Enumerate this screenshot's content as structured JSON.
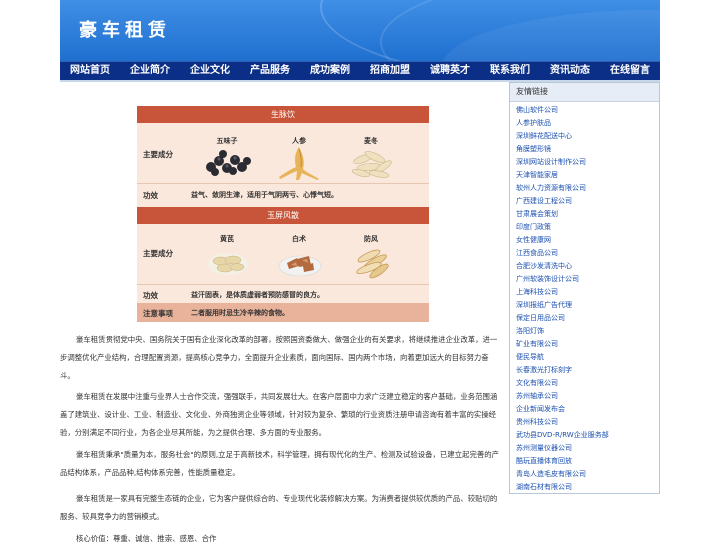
{
  "header": {
    "title": "豪车租赁"
  },
  "nav": {
    "items": [
      "网站首页",
      "企业简介",
      "企业文化",
      "产品服务",
      "成功案例",
      "招商加盟",
      "诚聘英才",
      "联系我们",
      "资讯动态",
      "在线留言"
    ]
  },
  "image": {
    "panel1": {
      "title": "生脉饮",
      "ingredients_label": "主要成分",
      "herbs": [
        "五味子",
        "人参",
        "麦冬"
      ],
      "effect_label": "功效",
      "effect_text": "益气、敛阴生津，适用于气阴两亏、心悸气短。"
    },
    "panel2": {
      "title": "玉屏风散",
      "ingredients_label": "主要成分",
      "herbs": [
        "黄芪",
        "白术",
        "防风"
      ],
      "effect_label": "功效",
      "effect_text": "益汗固表，是体质虚弱者预防感冒的良方。",
      "notes_label": "注意事项",
      "notes_text": "二者服用时忌生冷辛辣的食物。"
    }
  },
  "article": {
    "p1": "豪车租赁贯彻党中央、国务院关于国有企业深化改革的部署，按照国资委做大、做强企业的有关要求，将继续推进企业改革，进一步调整优化产业结构，合理配置资源，提高核心竞争力，全面提升企业素质，面向国际、国内两个市场，向着更加远大的目标努力奋斗。",
    "p2": "豪车租赁在发展中注重与业界人士合作交流，强强联手，共同发展壮大。在客户层面中力求广泛建立稳定的客户基础，业务范围涵盖了建筑业、设计业、工业、制造业、文化业、外商独资企业等领域，针对较为复杂、繁琐的行业资质注册申请咨询有着丰富的实操经验，分别满足不同行业，为各企业尽其所能，为之提供合理、多方面的专业服务。",
    "p3": "豪车租赁秉承\"质量为本，服务社会\"的原则,立足于高新技术，科学管理，拥有现代化的生产、检测及试验设备，已建立起完善的产品结构体系，产品品种,结构体系完善，性能质量稳定。",
    "p4": "豪车租赁是一家具有完整生态链的企业，它为客户提供综合的、专业现代化装修解决方案。为消费者提供较优质的产品、较贴切的服务、较具竞争力的营销模式。",
    "p5": "核心价值：尊重、诚信、推崇、感恩、合作"
  },
  "sidebar": {
    "title": "友情链接",
    "links": [
      "佛山软件公司",
      "人参护肤品",
      "深圳鲜花配送中心",
      "角膜塑形镜",
      "深圳网站设计制作公司",
      "天津智能家居",
      "软州人力资源有限公司",
      "广西建设工程公司",
      "甘肃展会策划",
      "印度门政策",
      "女性健康网",
      "江西食品公司",
      "合肥沙发清洗中心",
      "广州软装饰设计公司",
      "上海科技公司",
      "深圳报纸广告代理",
      "保定日用品公司",
      "洛阳灯饰",
      "矿业有限公司",
      "便民导航",
      "长春激光打标刻字",
      "文化有限公司",
      "苏州轴承公司",
      "企业新闻发布会",
      "贵州科技公司",
      "武功县DVD-R/RW企业服务部",
      "苏州测量仪器公司",
      "酷玩直播体育回放",
      "青岛人造毛皮有限公司",
      "湖南石材有限公司"
    ]
  },
  "colors": {
    "header": "#2a7ddc",
    "nav": "#0b2f86",
    "panel_head": "#c8553a",
    "panel_body": "#fbe8dc",
    "link": "#1a4fb0"
  }
}
